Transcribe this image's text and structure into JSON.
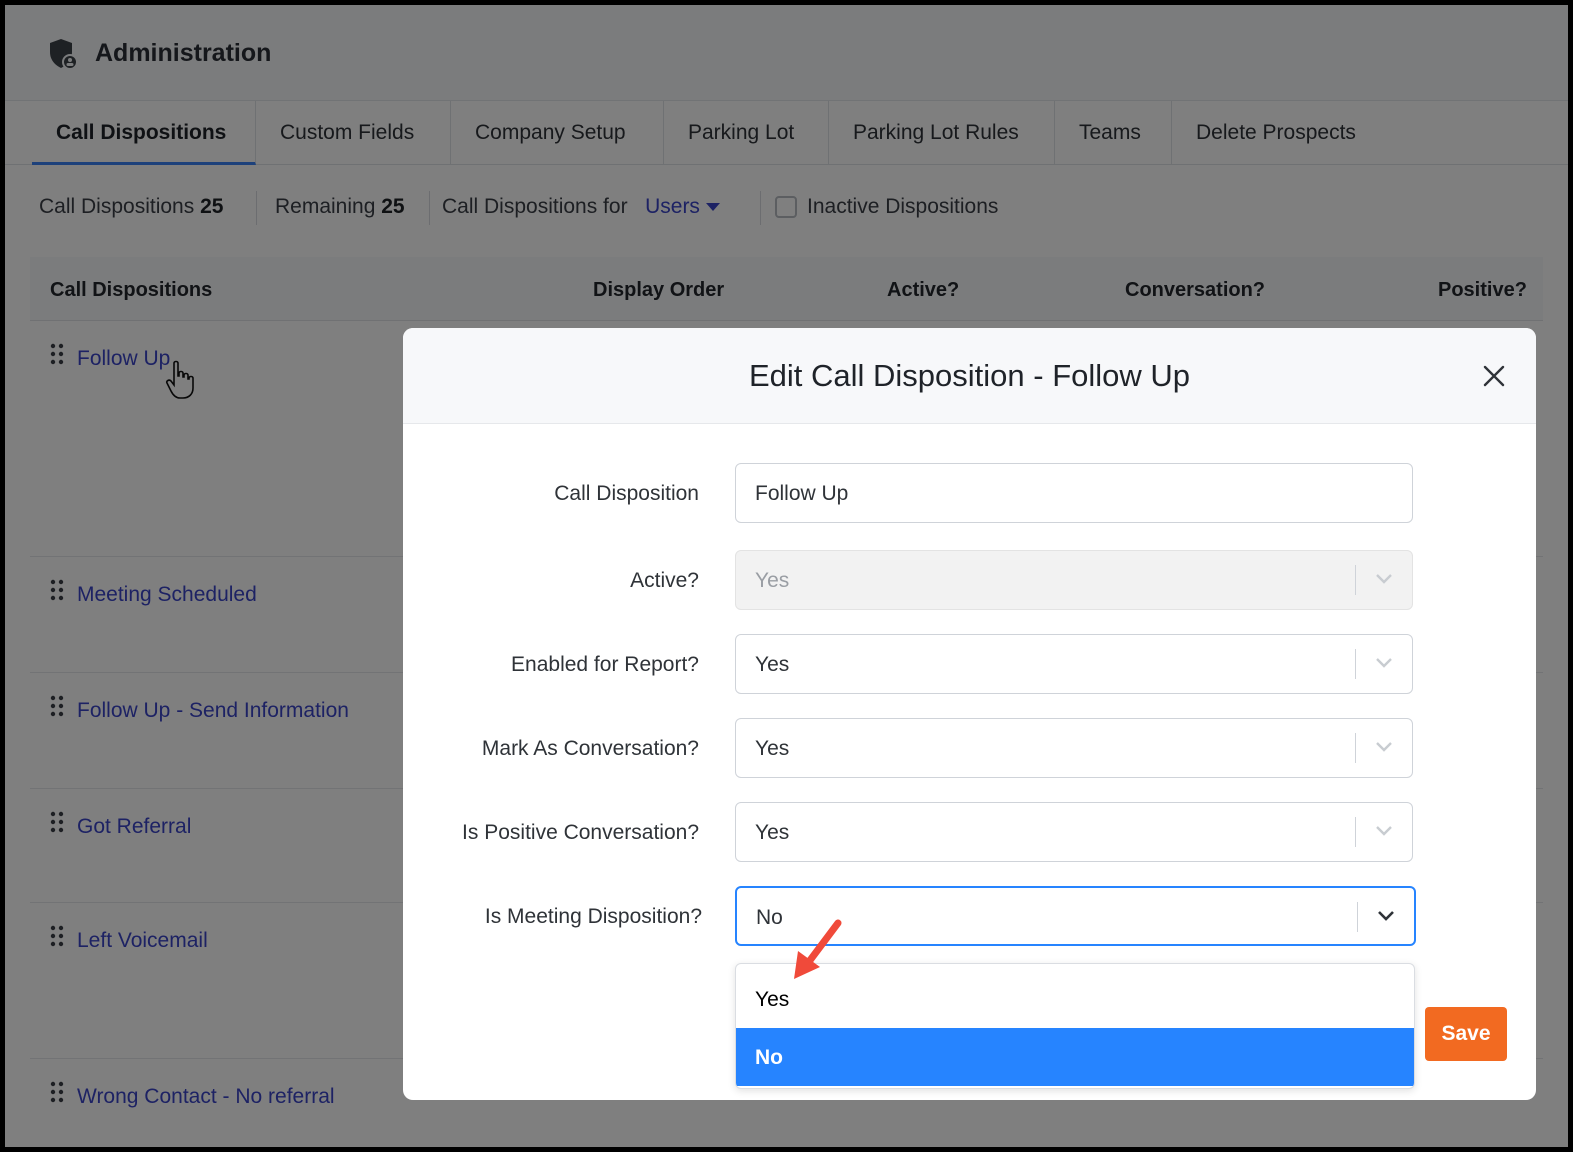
{
  "header": {
    "title": "Administration",
    "icon": "shield-icon"
  },
  "tabs": [
    {
      "label": "Call Dispositions",
      "active": true
    },
    {
      "label": "Custom Fields"
    },
    {
      "label": "Company Setup"
    },
    {
      "label": "Parking Lot"
    },
    {
      "label": "Parking Lot Rules"
    },
    {
      "label": "Teams"
    },
    {
      "label": "Delete Prospects"
    }
  ],
  "stats": {
    "count_label": "Call Dispositions",
    "count_value": "25",
    "remaining_label": "Remaining",
    "remaining_value": "25",
    "for_label": "Call Dispositions for",
    "for_value": "Users",
    "inactive_label": "Inactive Dispositions"
  },
  "table": {
    "columns": [
      "Call Dispositions",
      "Display Order",
      "Active?",
      "Conversation?",
      "Positive?"
    ],
    "rows": [
      "Follow Up",
      "Meeting Scheduled",
      "Follow Up - Send Information",
      "Got Referral",
      "Left Voicemail",
      "Wrong Contact - No referral"
    ]
  },
  "modal": {
    "title": "Edit Call Disposition - Follow Up",
    "fields": {
      "call_disposition": {
        "label": "Call Disposition",
        "value": "Follow Up"
      },
      "active": {
        "label": "Active?",
        "value": "Yes"
      },
      "enabled_report": {
        "label": "Enabled for Report?",
        "value": "Yes"
      },
      "mark_conversation": {
        "label": "Mark As Conversation?",
        "value": "Yes"
      },
      "positive_conversation": {
        "label": "Is Positive Conversation?",
        "value": "Yes"
      },
      "meeting_disposition": {
        "label": "Is Meeting Disposition?",
        "value": "No"
      }
    },
    "dropdown_options": [
      "Yes",
      "No"
    ],
    "selected_option": "No",
    "save_label": "Save"
  },
  "colors": {
    "accent": "#2684ff",
    "link": "#3a44c8",
    "save": "#f26a21",
    "annotation_arrow": "#f04a3a"
  }
}
